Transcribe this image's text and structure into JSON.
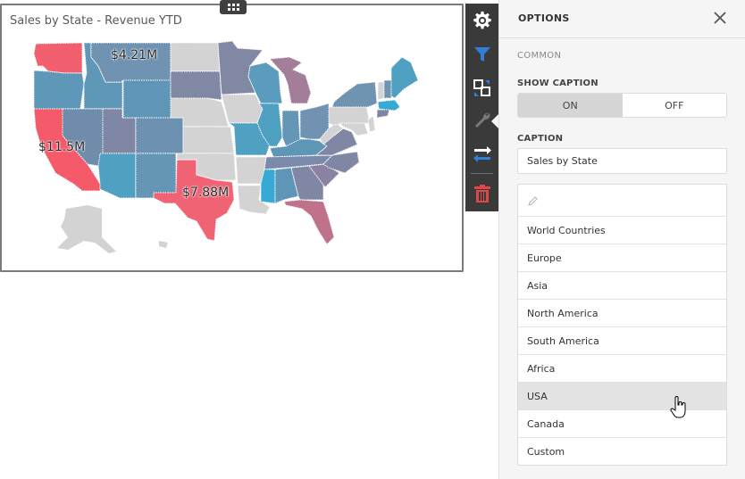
{
  "dashboard_item": {
    "caption": "Sales by State - Revenue YTD",
    "map_labels": [
      {
        "state": "Montana",
        "value": "$4.21M"
      },
      {
        "state": "California",
        "value": "$11.5M"
      },
      {
        "state": "Texas",
        "value": "$7.88M"
      }
    ],
    "colors": {
      "high": "#f25f6e",
      "mid_high": "#c0728a",
      "mid": "#8088a4",
      "mid_low": "#6f93b1",
      "low": "#4ea2c3",
      "lowest": "#36aad4",
      "no_data": "#d3d3d3"
    }
  },
  "toolbar": {
    "buttons": [
      {
        "name": "settings",
        "icon": "gear-icon"
      },
      {
        "name": "filter",
        "icon": "funnel-icon"
      },
      {
        "name": "convert",
        "icon": "convert-icon"
      },
      {
        "name": "options",
        "icon": "wrench-icon",
        "active": true
      },
      {
        "name": "interactivity",
        "icon": "swap-arrows-icon"
      },
      {
        "name": "delete",
        "icon": "trash-icon"
      }
    ],
    "accent": "#2f80d6",
    "danger": "#e04848"
  },
  "options_panel": {
    "title": "OPTIONS",
    "section": "COMMON",
    "show_caption_label": "SHOW CAPTION",
    "toggle": {
      "on": "ON",
      "off": "OFF",
      "selected": "ON"
    },
    "caption_label": "CAPTION",
    "caption_value": "Sales by State",
    "map_list": {
      "items": [
        "World Countries",
        "Europe",
        "Asia",
        "North America",
        "South America",
        "Africa",
        "USA",
        "Canada",
        "Custom"
      ],
      "hovered": "USA"
    }
  }
}
